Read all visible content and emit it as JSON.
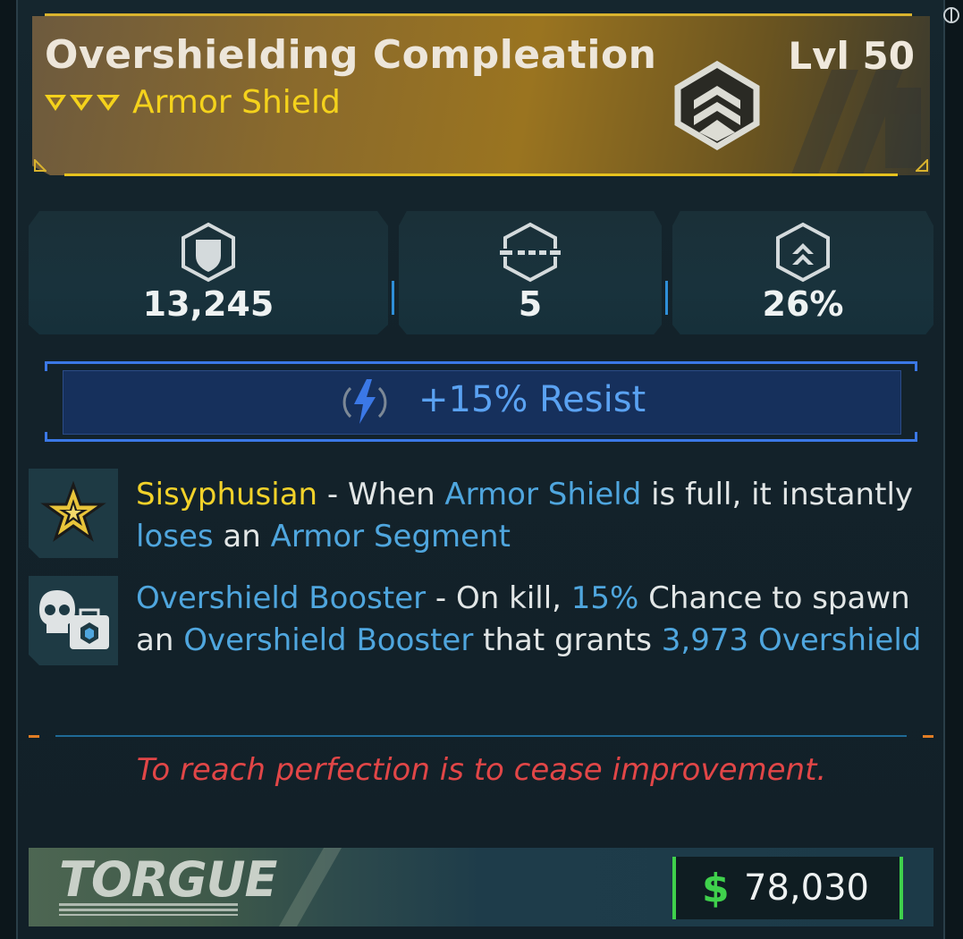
{
  "item": {
    "name": "Overshielding Compleation",
    "level": "Lvl 50",
    "type": "Armor Shield",
    "rarity_icon": "rarity-chevrons-icon",
    "type_emblem": "armor-shield-emblem-icon"
  },
  "stats": [
    {
      "icon": "shield-capacity-icon",
      "value": "13,245"
    },
    {
      "icon": "armor-segment-icon",
      "value": "5"
    },
    {
      "icon": "recharge-rate-icon",
      "value": "26%"
    }
  ],
  "element": {
    "icon": "shock-lightning-icon",
    "text": "+15% Resist"
  },
  "perks": [
    {
      "icon": "gold-star-perk-icon",
      "parts": [
        {
          "t": "Sisyphusian",
          "c": "yellow"
        },
        {
          "t": " - When ",
          "c": "white"
        },
        {
          "t": "Armor Shield",
          "c": "blue"
        },
        {
          "t": " is full, it instantly ",
          "c": "white"
        },
        {
          "t": "loses",
          "c": "blue"
        },
        {
          "t": " an ",
          "c": "white"
        },
        {
          "t": "Armor Segment",
          "c": "blue"
        }
      ]
    },
    {
      "icon": "skull-booster-perk-icon",
      "parts": [
        {
          "t": "Overshield Booster",
          "c": "blue"
        },
        {
          "t": " - On kill, ",
          "c": "white"
        },
        {
          "t": "15%",
          "c": "blue"
        },
        {
          "t": " Chance to spawn an ",
          "c": "white"
        },
        {
          "t": "Overshield Booster",
          "c": "blue"
        },
        {
          "t": " that grants ",
          "c": "white"
        },
        {
          "t": "3,973",
          "c": "blue"
        },
        {
          "t": " Overshield",
          "c": "blue"
        }
      ]
    }
  ],
  "flavor_text": "To reach perfection is to cease improvement.",
  "manufacturer": "TORGUE",
  "price": {
    "symbol": "$",
    "value": "78,030"
  },
  "colors": {
    "legendary": "#e6c21e",
    "highlight_blue": "#4fa6de",
    "flavor_red": "#e14647",
    "price_green": "#3fd14c",
    "shock_blue": "#3b78e6"
  }
}
